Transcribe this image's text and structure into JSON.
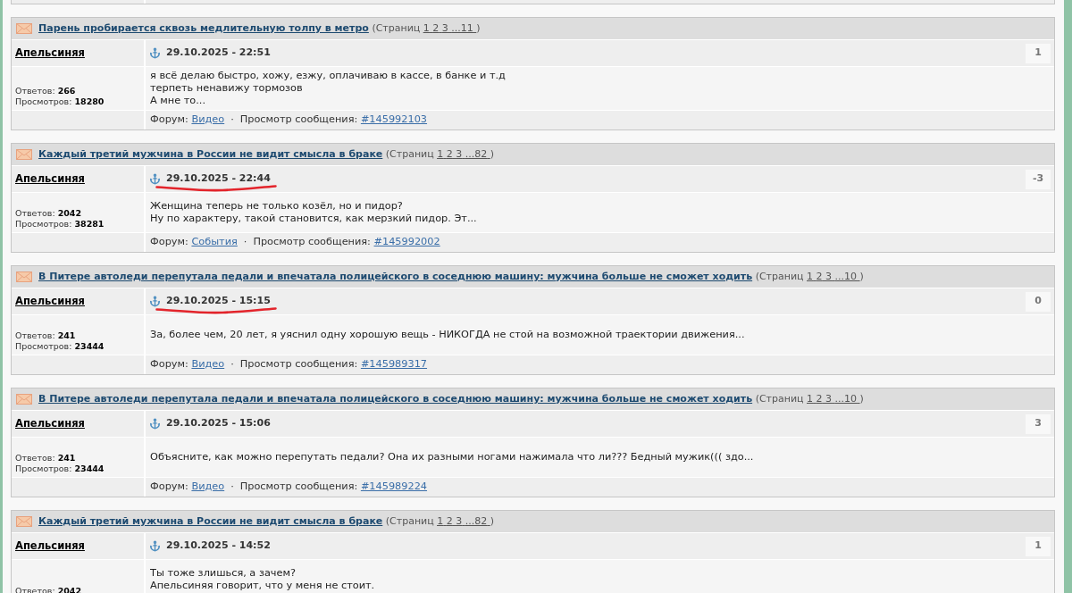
{
  "posts": [
    {
      "title": "Парень пробирается сквозь медлительную толпу в метро",
      "pages_label": "(Страниц",
      "pages": [
        "1",
        "2",
        "3",
        "...11"
      ],
      "pages_close": ")",
      "author": "Апельсиняя",
      "date": "29.10.2025 - 22:51",
      "annotated": false,
      "rating": "1",
      "stats": [
        {
          "label": "Ответов:",
          "value": "266"
        },
        {
          "label": "Просмотров:",
          "value": "18280"
        }
      ],
      "body": [
        "я всё делаю быстро, хожу, езжу, оплачиваю в кассе, в банке и т.д",
        "терпеть ненавижу тормозов",
        "А мне то..."
      ],
      "footer": {
        "forum_label": "Форум:",
        "forum": "Видео",
        "separator": "·",
        "view_label": "Просмотр сообщения:",
        "post_link": "#145992103"
      }
    },
    {
      "title": "Каждый третий мужчина в России не видит смысла в браке",
      "pages_label": "(Страниц",
      "pages": [
        "1",
        "2",
        "3",
        "...82"
      ],
      "pages_close": ")",
      "author": "Апельсиняя",
      "date": "29.10.2025 - 22:44",
      "annotated": true,
      "rating": "-3",
      "stats": [
        {
          "label": "Ответов:",
          "value": "2042"
        },
        {
          "label": "Просмотров:",
          "value": "38281"
        }
      ],
      "body": [
        "Женщина теперь не только козёл, но и пидор?",
        "Ну по характеру, такой становится, как мерзкий пидор. Эт..."
      ],
      "footer": {
        "forum_label": "Форум:",
        "forum": "События",
        "separator": "·",
        "view_label": "Просмотр сообщения:",
        "post_link": "#145992002"
      }
    },
    {
      "title": "В Питере автоледи перепутала педали и впечатала полицейского в соседнюю машину: мужчина больше не сможет ходить",
      "pages_label": "(Страниц",
      "pages": [
        "1",
        "2",
        "3",
        "...10"
      ],
      "pages_close": ")",
      "author": "Апельсиняя",
      "date": "29.10.2025 - 15:15",
      "annotated": true,
      "rating": "0",
      "stats": [
        {
          "label": "Ответов:",
          "value": "241"
        },
        {
          "label": "Просмотров:",
          "value": "23444"
        }
      ],
      "body": [
        "За, более чем, 20 лет, я уяснил одну хорошую вещь - НИКОГДА не стой на возможной траектории движения..."
      ],
      "footer": {
        "forum_label": "Форум:",
        "forum": "Видео",
        "separator": "·",
        "view_label": "Просмотр сообщения:",
        "post_link": "#145989317"
      }
    },
    {
      "title": "В Питере автоледи перепутала педали и впечатала полицейского в соседнюю машину: мужчина больше не сможет ходить",
      "pages_label": "(Страниц",
      "pages": [
        "1",
        "2",
        "3",
        "...10"
      ],
      "pages_close": ")",
      "author": "Апельсиняя",
      "date": "29.10.2025 - 15:06",
      "annotated": false,
      "rating": "3",
      "stats": [
        {
          "label": "Ответов:",
          "value": "241"
        },
        {
          "label": "Просмотров:",
          "value": "23444"
        }
      ],
      "body": [
        "Объясните, как можно перепутать педали? Она их разными ногами нажимала что ли??? Бедный мужик((( здо..."
      ],
      "footer": {
        "forum_label": "Форум:",
        "forum": "Видео",
        "separator": "·",
        "view_label": "Просмотр сообщения:",
        "post_link": "#145989224"
      }
    },
    {
      "title": "Каждый третий мужчина в России не видит смысла в браке",
      "pages_label": "(Страниц",
      "pages": [
        "1",
        "2",
        "3",
        "...82"
      ],
      "pages_close": ")",
      "author": "Апельсиняя",
      "date": "29.10.2025 - 14:52",
      "annotated": false,
      "rating": "1",
      "stats": [
        {
          "label": "Ответов:",
          "value": "2042"
        }
      ],
      "body": [
        "Ты тоже злишься, а зачем?",
        "Апельсиняя говорит, что у меня не стоит."
      ]
    }
  ]
}
